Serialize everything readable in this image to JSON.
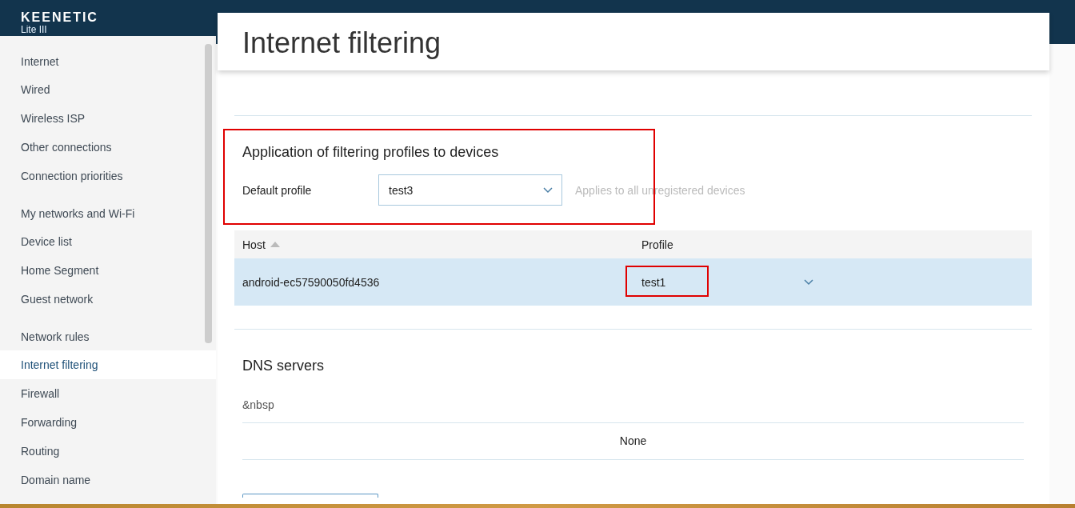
{
  "brand": {
    "logo": "KEENETIC",
    "model": "Lite III"
  },
  "sidebar": {
    "groups": [
      {
        "title": "Internet",
        "items": [
          {
            "label": "Wired",
            "selected": false
          },
          {
            "label": "Wireless ISP",
            "selected": false
          },
          {
            "label": "Other connections",
            "selected": false
          },
          {
            "label": "Connection priorities",
            "selected": false
          }
        ]
      },
      {
        "title": "My networks and Wi-Fi",
        "items": [
          {
            "label": "Device list",
            "selected": false
          },
          {
            "label": "Home Segment",
            "selected": false
          },
          {
            "label": "Guest network",
            "selected": false
          }
        ]
      },
      {
        "title": "Network rules",
        "items": [
          {
            "label": "Internet filtering",
            "selected": true
          },
          {
            "label": "Firewall",
            "selected": false
          },
          {
            "label": "Forwarding",
            "selected": false
          },
          {
            "label": "Routing",
            "selected": false
          },
          {
            "label": "Domain name",
            "selected": false
          }
        ]
      }
    ]
  },
  "page": {
    "title": "Internet filtering"
  },
  "profiles_section": {
    "title": "Application of filtering profiles to devices",
    "highlighted": true,
    "default_profile": {
      "label": "Default profile",
      "value": "test3",
      "hint": "Applies to all unregistered devices"
    },
    "table": {
      "columns": [
        {
          "label": "Host",
          "sorted": true
        },
        {
          "label": "Profile",
          "sorted": false
        }
      ],
      "rows": [
        {
          "host": "android-ec57590050fd4536",
          "profile": "test1",
          "selected": true,
          "highlighted": true
        }
      ]
    }
  },
  "dns_section": {
    "title": "DNS servers",
    "label": "&nbsp",
    "empty_text": "None"
  }
}
